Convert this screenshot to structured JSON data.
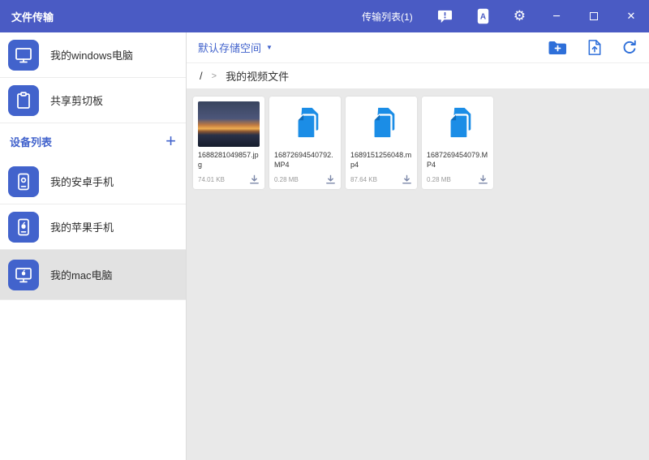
{
  "colors": {
    "titlebar_bg": "#4a5bc4",
    "accent_blue": "#4263cc",
    "file_icon_blue": "#1b8de6",
    "content_bg": "#e9e9e9"
  },
  "icons": {
    "settings": "⚙",
    "minimize": "─",
    "close": "✕",
    "caret_down": "▼",
    "plus": "+"
  },
  "titlebar": {
    "title": "文件传输",
    "transfer_list_label": "传输列表(1)"
  },
  "sidebar": {
    "shortcuts": [
      {
        "label": "我的windows电脑",
        "icon": "windows-computer-icon"
      },
      {
        "label": "共享剪切板",
        "icon": "clipboard-icon"
      }
    ],
    "device_section": {
      "title": "设备列表"
    },
    "devices": [
      {
        "label": "我的安卓手机",
        "icon": "android-phone-icon",
        "selected": false
      },
      {
        "label": "我的苹果手机",
        "icon": "apple-phone-icon",
        "selected": false
      },
      {
        "label": "我的mac电脑",
        "icon": "mac-computer-icon",
        "selected": true
      }
    ]
  },
  "toolbar": {
    "storage_selector": "默认存储空间"
  },
  "breadcrumb": {
    "root": "/",
    "separator": ">",
    "current_folder": "我的视频文件"
  },
  "files": [
    {
      "name": "1688281049857.jpg",
      "size": "74.01 KB",
      "kind": "image"
    },
    {
      "name": "16872694540792.MP4",
      "size": "0.28 MB",
      "kind": "video"
    },
    {
      "name": "1689151256048.mp4",
      "size": "87.64 KB",
      "kind": "video"
    },
    {
      "name": "1687269454079.MP4",
      "size": "0.28 MB",
      "kind": "video"
    }
  ]
}
